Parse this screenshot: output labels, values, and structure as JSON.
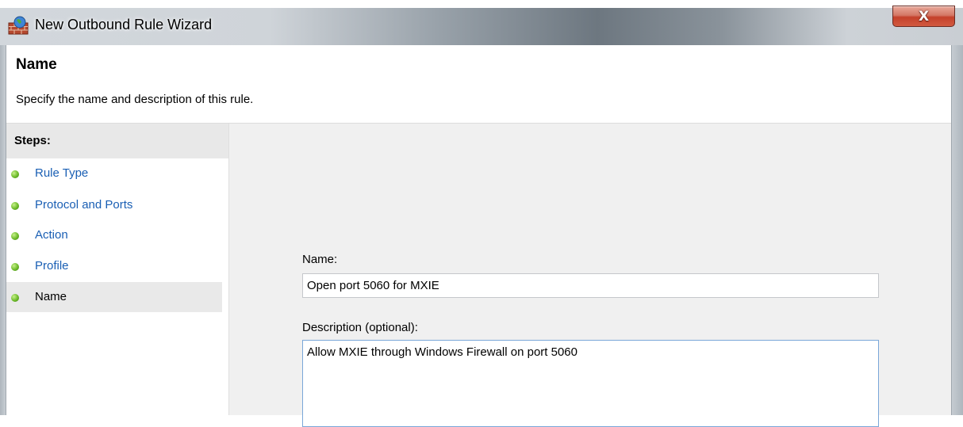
{
  "window": {
    "title": "New Outbound Rule Wizard",
    "close_label": "X"
  },
  "header": {
    "title": "Name",
    "subtitle": "Specify the name and description of this rule."
  },
  "steps": {
    "heading": "Steps:",
    "items": [
      {
        "label": "Rule Type",
        "current": false
      },
      {
        "label": "Protocol and Ports",
        "current": false
      },
      {
        "label": "Action",
        "current": false
      },
      {
        "label": "Profile",
        "current": false
      },
      {
        "label": "Name",
        "current": true
      }
    ]
  },
  "form": {
    "name_label": "Name:",
    "name_value": "Open port 5060 for MXIE",
    "description_label": "Description (optional):",
    "description_value": "Allow MXIE through Windows Firewall on port 5060"
  },
  "colors": {
    "link": "#1a5fb4",
    "step_dot": "#6dbb2a",
    "close_button": "#c4412b",
    "content_background": "#f0f0f0"
  },
  "icons": {
    "app": "firewall-globe-icon",
    "step": "green-bullet-icon"
  }
}
